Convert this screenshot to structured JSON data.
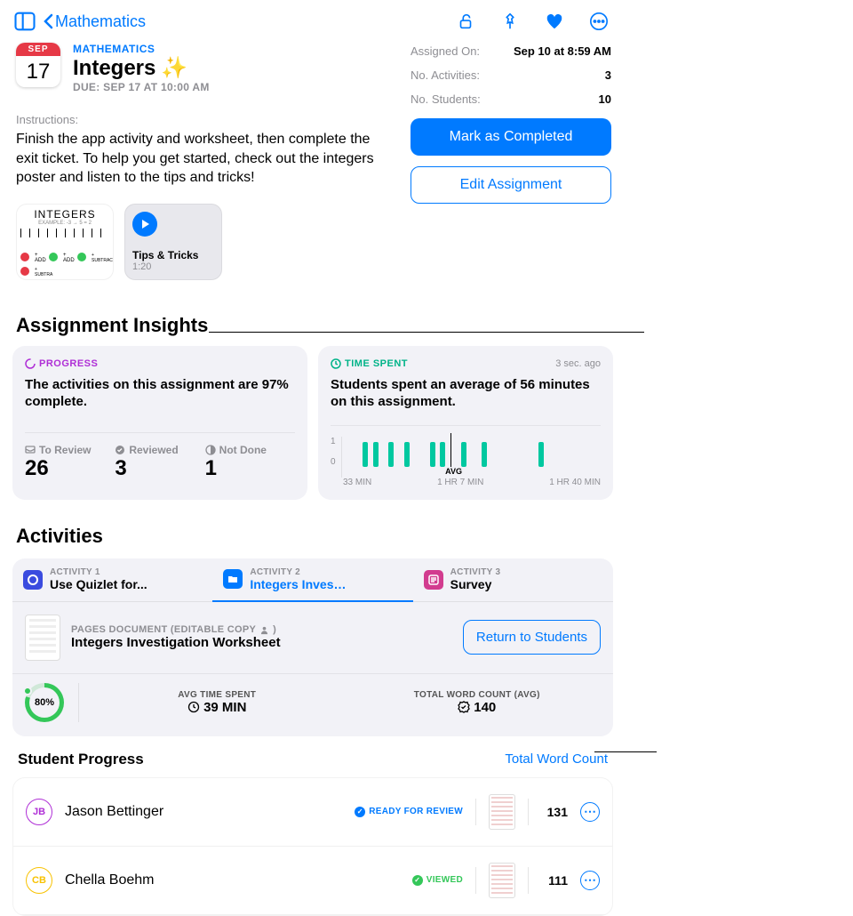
{
  "nav": {
    "back_label": "Mathematics"
  },
  "cal": {
    "month": "SEP",
    "day": "17"
  },
  "assignment": {
    "subject": "MATHEMATICS",
    "title": "Integers",
    "sparkle": "✨",
    "due": "DUE: SEP 17 AT 10:00 AM"
  },
  "meta": {
    "assigned_label": "Assigned On:",
    "assigned_value": "Sep 10 at 8:59 AM",
    "activities_label": "No. Activities:",
    "activities_value": "3",
    "students_label": "No. Students:",
    "students_value": "10"
  },
  "buttons": {
    "complete": "Mark as Completed",
    "edit": "Edit Assignment",
    "return_students": "Return to Students"
  },
  "instructions": {
    "label": "Instructions:",
    "text": "Finish the app activity and worksheet, then complete the exit ticket. To help you get started, check out the integers poster and listen to the tips and tricks!"
  },
  "attachments": {
    "poster_title": "INTEGERS",
    "video_title": "Tips & Tricks",
    "video_duration": "1:20"
  },
  "sections": {
    "insights": "Assignment Insights",
    "activities": "Activities",
    "student_progress": "Student Progress",
    "word_count_link": "Total Word Count"
  },
  "insights": {
    "progress_tag": "PROGRESS",
    "progress_desc": "The activities on this assignment are 97% complete.",
    "review_label": "To Review",
    "review_value": "26",
    "reviewed_label": "Reviewed",
    "reviewed_value": "3",
    "notdone_label": "Not Done",
    "notdone_value": "1",
    "time_tag": "TIME SPENT",
    "time_ago": "3 sec. ago",
    "time_desc": "Students spent an average of 56 minutes on this assignment.",
    "y_top": "1",
    "y_bot": "0",
    "x_left": "33 MIN",
    "x_mid": "1 HR 7 MIN",
    "x_right": "1 HR 40 MIN",
    "avg_label": "AVG"
  },
  "tabs": [
    {
      "overline": "ACTIVITY 1",
      "label": "Use Quizlet for..."
    },
    {
      "overline": "ACTIVITY 2",
      "label": "Integers Investi..."
    },
    {
      "overline": "ACTIVITY 3",
      "label": "Survey"
    }
  ],
  "doc": {
    "kind": "PAGES DOCUMENT (EDITABLE COPY",
    "title": "Integers Investigation Worksheet"
  },
  "metrics": {
    "pct": "80%",
    "time_label": "AVG TIME SPENT",
    "time_value": "39 MIN",
    "wc_label": "TOTAL WORD COUNT (AVG)",
    "wc_value": "140"
  },
  "students": [
    {
      "initials": "JB",
      "ring": "#af2fd6",
      "name": "Jason Bettinger",
      "status": "READY FOR REVIEW",
      "status_color": "#007aff",
      "count": "131"
    },
    {
      "initials": "CB",
      "ring": "#f8c200",
      "name": "Chella Boehm",
      "status": "VIEWED",
      "status_color": "#34c759",
      "count": "111"
    }
  ]
}
